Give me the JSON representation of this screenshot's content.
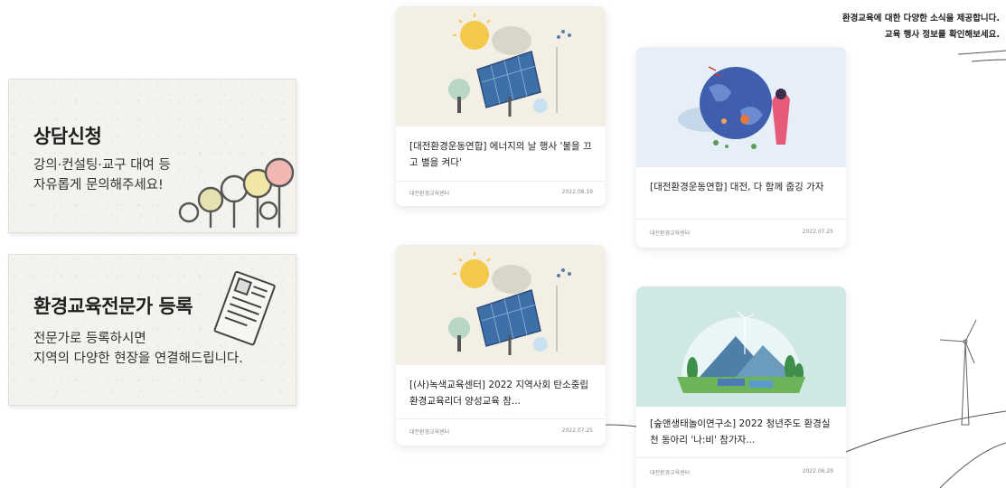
{
  "side_cards": {
    "consult": {
      "title": "상담신청",
      "desc_line1": "강의·컨설팅·교구 대여 등",
      "desc_line2": "자유롭게 문의해주세요!",
      "icon": "lightbulbs-icon"
    },
    "expert": {
      "title": "환경교육전문가 등록",
      "desc_line1": "전문가로 등록하시면",
      "desc_line2": "지역의 다양한 현장을 연결해드립니다.",
      "icon": "document-icon"
    }
  },
  "intro": {
    "line1": "환경교육에 대한 다양한 소식을 제공합니다.",
    "line2": "교육 행사 정보를 확인해보세요."
  },
  "news": [
    {
      "title": "[대전환경운동연합] 에너지의 날 행사 '불을 끄고 별을 켜다'",
      "org": "대전환경교육센터",
      "date": "2022.08.19",
      "thumb_icon": "solar-panel-illustration"
    },
    {
      "title": "[대전환경운동연합] 대전, 다 함께 줍깅 가자",
      "org": "대전환경교육센터",
      "date": "2022.07.25",
      "thumb_icon": "earth-illustration"
    },
    {
      "title": "[(사)녹색교육센터] 2022 지역사회 탄소중립 환경교육리더 양성교육 참...",
      "org": "대전환경교육센터",
      "date": "2022.07.25",
      "thumb_icon": "solar-panel-illustration"
    },
    {
      "title": "[숲앤생태놀이연구소] 2022 청년주도 환경실천 동아리 '나:비' 참가자...",
      "org": "대전환경교육센터",
      "date": "2022.06.29",
      "thumb_icon": "green-landscape-illustration"
    }
  ],
  "decoration": {
    "icon": "wind-turbine-icon"
  }
}
